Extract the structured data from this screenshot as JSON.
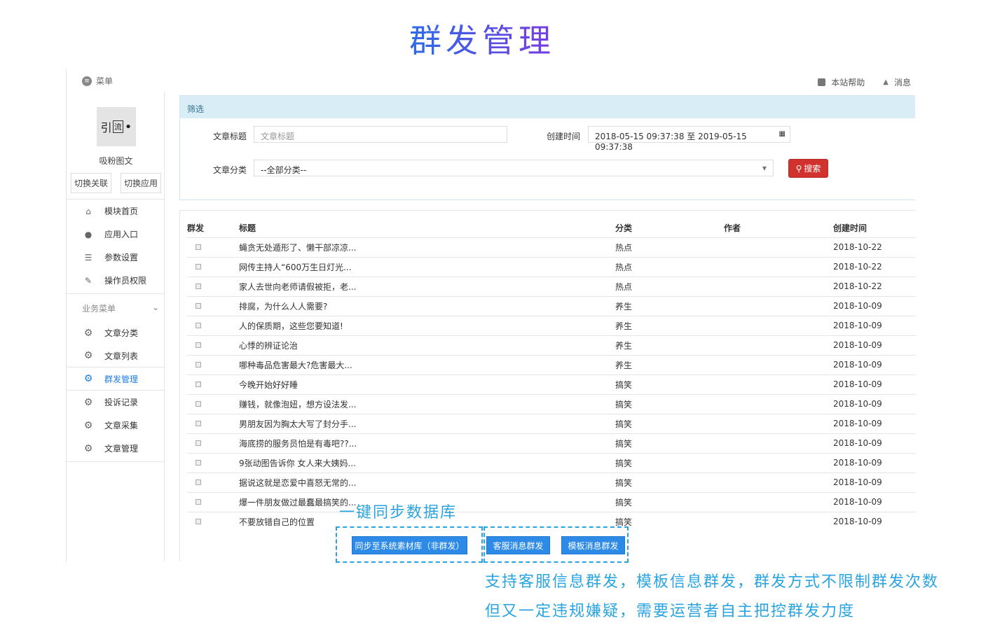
{
  "page_title": "群发管理",
  "topbar": {
    "menu_label": "菜单",
    "help_label": "本站帮助",
    "message_label": "消息"
  },
  "sidebar": {
    "logo_text": "引流吸粉",
    "app_name": "吸粉图文",
    "switch_link": "切换关联",
    "switch_app": "切换应用",
    "items_top": [
      {
        "label": "模块首页",
        "icon": "home-icon"
      },
      {
        "label": "应用入口",
        "icon": "chat-icon"
      },
      {
        "label": "参数设置",
        "icon": "list-icon"
      },
      {
        "label": "操作员权限",
        "icon": "edit-icon"
      }
    ],
    "section_label": "业务菜单",
    "items_business": [
      {
        "label": "文章分类",
        "icon": "gear-icon"
      },
      {
        "label": "文章列表",
        "icon": "gear-icon"
      },
      {
        "label": "群发管理",
        "icon": "gear-icon",
        "active": true
      },
      {
        "label": "投诉记录",
        "icon": "gear-icon"
      },
      {
        "label": "文章采集",
        "icon": "gear-icon"
      },
      {
        "label": "文章管理",
        "icon": "gear-icon"
      }
    ]
  },
  "filter": {
    "header": "筛选",
    "title_label": "文章标题",
    "title_placeholder": "文章标题",
    "time_label": "创建时间",
    "time_value": "2018-05-15 09:37:38 至 2019-05-15 09:37:38",
    "category_label": "文章分类",
    "category_value": "--全部分类--",
    "search_label": "搜索"
  },
  "table": {
    "headers": [
      "群发",
      "标题",
      "分类",
      "作者",
      "创建时间"
    ],
    "rows": [
      {
        "title": "蝇贪无处遁形了、懒干部凉凉...",
        "category": "热点",
        "author": "",
        "date": "2018-10-22"
      },
      {
        "title": "网传主持人“600万生日灯光...",
        "category": "热点",
        "author": "",
        "date": "2018-10-22"
      },
      {
        "title": "家人去世向老师请假被拒，老...",
        "category": "热点",
        "author": "",
        "date": "2018-10-22"
      },
      {
        "title": "排腐，为什么人人需要?",
        "category": "养生",
        "author": "",
        "date": "2018-10-09"
      },
      {
        "title": "人的保质期，这些您要知道!",
        "category": "养生",
        "author": "",
        "date": "2018-10-09"
      },
      {
        "title": "心悸的辨证论治",
        "category": "养生",
        "author": "",
        "date": "2018-10-09"
      },
      {
        "title": "哪种毒品危害最大?危害最大...",
        "category": "养生",
        "author": "",
        "date": "2018-10-09"
      },
      {
        "title": "今晚开始好好睡",
        "category": "搞笑",
        "author": "",
        "date": "2018-10-09"
      },
      {
        "title": "赚钱，就像泡妞，想方设法发...",
        "category": "搞笑",
        "author": "",
        "date": "2018-10-09"
      },
      {
        "title": "男朋友因为胸太大写了封分手...",
        "category": "搞笑",
        "author": "",
        "date": "2018-10-09"
      },
      {
        "title": "海底捞的服务员怕是有毒吧??...",
        "category": "搞笑",
        "author": "",
        "date": "2018-10-09"
      },
      {
        "title": "9张动图告诉你 女人来大姨妈...",
        "category": "搞笑",
        "author": "",
        "date": "2018-10-09"
      },
      {
        "title": "据说这就是恋爱中喜怒无常的...",
        "category": "搞笑",
        "author": "",
        "date": "2018-10-09"
      },
      {
        "title": "爆一件朋友做过最蠢最搞笑的...",
        "category": "搞笑",
        "author": "",
        "date": "2018-10-09"
      },
      {
        "title": "不要放错自己的位置",
        "category": "搞笑",
        "author": "",
        "date": "2018-10-09"
      }
    ]
  },
  "actions": {
    "sync_label": "同步至系统素材库（非群发）",
    "service_label": "客服消息群发",
    "template_label": "模板消息群发"
  },
  "annotations": {
    "sync_note": "一键同步数据库",
    "line1": "支持客服信息群发，模板信息群发，群发方式不限制群发次数",
    "line2": "但又一定违规嫌疑，需要运营者自主把控群发力度"
  },
  "colors": {
    "accent": "#2d8ae6",
    "annotation": "#2aa4e0",
    "danger": "#d2322d",
    "filter_header_bg": "#d9edf7"
  }
}
